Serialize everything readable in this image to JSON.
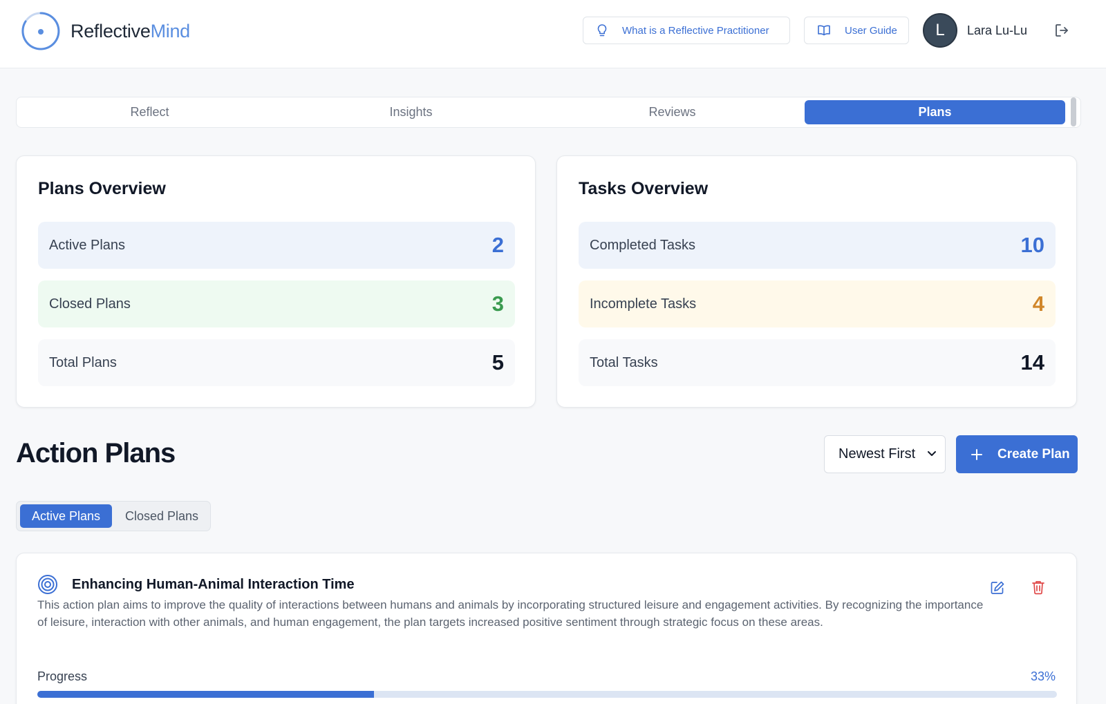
{
  "header": {
    "logo_part1": "Reflective",
    "logo_part2": "Mind",
    "reflective_btn_label": "What is a Reflective Practitioner",
    "guide_btn_label": "User Guide",
    "avatar_initial": "L",
    "username": "Lara Lu-Lu"
  },
  "tabs": [
    {
      "label": "Reflect",
      "active": false
    },
    {
      "label": "Insights",
      "active": false
    },
    {
      "label": "Reviews",
      "active": false
    },
    {
      "label": "Plans",
      "active": true
    }
  ],
  "plans_overview": {
    "title": "Plans Overview",
    "stats": [
      {
        "label": "Active Plans",
        "value": "2",
        "color": "#3b6fd4"
      },
      {
        "label": "Closed Plans",
        "value": "3",
        "color": "#3a9a4f"
      },
      {
        "label": "Total Plans",
        "value": "5",
        "color": "#111827"
      }
    ]
  },
  "tasks_overview": {
    "title": "Tasks Overview",
    "stats": [
      {
        "label": "Completed Tasks",
        "value": "10",
        "color": "#3b6fd4"
      },
      {
        "label": "Incomplete Tasks",
        "value": "4",
        "color": "#d0862a"
      },
      {
        "label": "Total Tasks",
        "value": "14",
        "color": "#111827"
      }
    ]
  },
  "action_plans": {
    "title": "Action Plans",
    "sort_selected": "Newest First",
    "create_label": "Create Plan",
    "segments": {
      "active": "Active Plans",
      "closed": "Closed Plans"
    },
    "plan": {
      "title": "Enhancing Human-Animal Interaction Time",
      "description": "This action plan aims to improve the quality of interactions between humans and animals by incorporating structured leisure and engagement activities. By recognizing the importance of leisure, interaction with other animals, and human engagement, the plan targets increased positive sentiment through strategic focus on these areas.",
      "progress_label": "Progress",
      "progress_text": "33%",
      "progress_value": 0.33
    }
  },
  "colors": {
    "accent": "#3b6fd4",
    "accent_light": "#5a8ee0",
    "delete": "#e04848"
  }
}
